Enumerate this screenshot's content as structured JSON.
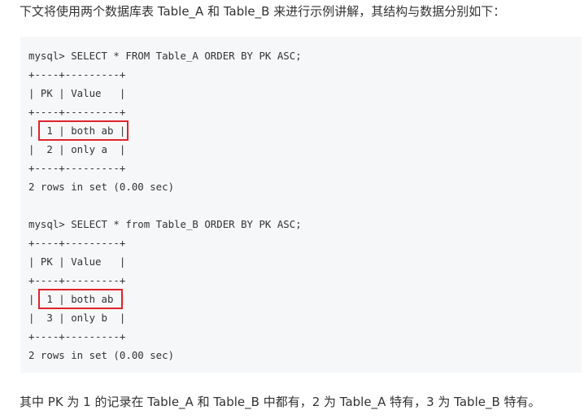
{
  "intro_text": "下文将使用两个数据库表 Table_A 和 Table_B 来进行示例讲解，其结构与数据分别如下：",
  "code_lines": [
    "mysql> SELECT * FROM Table_A ORDER BY PK ASC;",
    "+----+---------+",
    "| PK | Value   |",
    "+----+---------+",
    "|  1 | both ab |",
    "|  2 | only a  |",
    "+----+---------+",
    "2 rows in set (0.00 sec)",
    "",
    "mysql> SELECT * from Table_B ORDER BY PK ASC;",
    "+----+---------+",
    "| PK | Value   |",
    "+----+---------+",
    "|  1 | both ab |",
    "|  3 | only b  |",
    "+----+---------+",
    "2 rows in set (0.00 sec)"
  ],
  "highlight_color": "#e0242c",
  "code_background": "#f6f7f9",
  "summary_text": "其中 PK 为 1 的记录在 Table_A 和 Table_B 中都有，2 为 Table_A 特有，3 为 Table_B 特有。"
}
